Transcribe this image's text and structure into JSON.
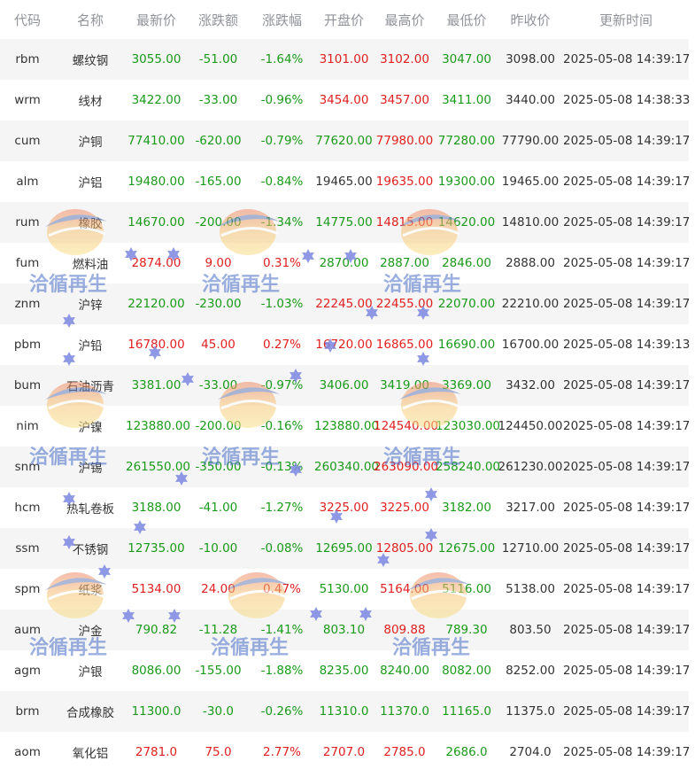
{
  "headers": [
    "代码",
    "名称",
    "最新价",
    "涨跌额",
    "涨跌幅",
    "开盘价",
    "最高价",
    "最低价",
    "昨收价",
    "更新时间"
  ],
  "colors": {
    "up": "#e02020",
    "down": "#1a9a1a",
    "flat": "#333333",
    "header": "#909399",
    "stripe": "#f5f5f5"
  },
  "rows": [
    {
      "code": "rbm",
      "name": "螺纹钢",
      "latest": "3055.00",
      "change": "-51.00",
      "pct": "-1.64%",
      "open": "3101.00",
      "high": "3102.00",
      "low": "3047.00",
      "prev": "3098.00",
      "time": "2025-05-08 14:39:17",
      "tone": {
        "latest": "down",
        "change": "down",
        "pct": "down",
        "open": "up",
        "high": "up",
        "low": "down"
      }
    },
    {
      "code": "wrm",
      "name": "线材",
      "latest": "3422.00",
      "change": "-33.00",
      "pct": "-0.96%",
      "open": "3454.00",
      "high": "3457.00",
      "low": "3411.00",
      "prev": "3440.00",
      "time": "2025-05-08 14:38:33",
      "tone": {
        "latest": "down",
        "change": "down",
        "pct": "down",
        "open": "up",
        "high": "up",
        "low": "down"
      }
    },
    {
      "code": "cum",
      "name": "沪铜",
      "latest": "77410.00",
      "change": "-620.00",
      "pct": "-0.79%",
      "open": "77620.00",
      "high": "77980.00",
      "low": "77280.00",
      "prev": "77790.00",
      "time": "2025-05-08 14:39:17",
      "tone": {
        "latest": "down",
        "change": "down",
        "pct": "down",
        "open": "down",
        "high": "up",
        "low": "down"
      }
    },
    {
      "code": "alm",
      "name": "沪铝",
      "latest": "19480.00",
      "change": "-165.00",
      "pct": "-0.84%",
      "open": "19465.00",
      "high": "19635.00",
      "low": "19300.00",
      "prev": "19465.00",
      "time": "2025-05-08 14:39:17",
      "tone": {
        "latest": "down",
        "change": "down",
        "pct": "down",
        "open": "flat",
        "high": "up",
        "low": "down"
      }
    },
    {
      "code": "rum",
      "name": "橡胶",
      "latest": "14670.00",
      "change": "-200.00",
      "pct": "-1.34%",
      "open": "14775.00",
      "high": "14815.00",
      "low": "14620.00",
      "prev": "14810.00",
      "time": "2025-05-08 14:39:17",
      "tone": {
        "latest": "down",
        "change": "down",
        "pct": "down",
        "open": "down",
        "high": "up",
        "low": "down"
      }
    },
    {
      "code": "fum",
      "name": "燃料油",
      "latest": "2874.00",
      "change": "9.00",
      "pct": "0.31%",
      "open": "2870.00",
      "high": "2887.00",
      "low": "2846.00",
      "prev": "2888.00",
      "time": "2025-05-08 14:39:17",
      "tone": {
        "latest": "up",
        "change": "up",
        "pct": "up",
        "open": "down",
        "high": "down",
        "low": "down"
      }
    },
    {
      "code": "znm",
      "name": "沪锌",
      "latest": "22120.00",
      "change": "-230.00",
      "pct": "-1.03%",
      "open": "22245.00",
      "high": "22455.00",
      "low": "22070.00",
      "prev": "22210.00",
      "time": "2025-05-08 14:39:17",
      "tone": {
        "latest": "down",
        "change": "down",
        "pct": "down",
        "open": "up",
        "high": "up",
        "low": "down"
      }
    },
    {
      "code": "pbm",
      "name": "沪铅",
      "latest": "16780.00",
      "change": "45.00",
      "pct": "0.27%",
      "open": "16720.00",
      "high": "16865.00",
      "low": "16690.00",
      "prev": "16700.00",
      "time": "2025-05-08 14:39:13",
      "tone": {
        "latest": "up",
        "change": "up",
        "pct": "up",
        "open": "up",
        "high": "up",
        "low": "down"
      }
    },
    {
      "code": "bum",
      "name": "石油沥青",
      "latest": "3381.00",
      "change": "-33.00",
      "pct": "-0.97%",
      "open": "3406.00",
      "high": "3419.00",
      "low": "3369.00",
      "prev": "3432.00",
      "time": "2025-05-08 14:39:17",
      "tone": {
        "latest": "down",
        "change": "down",
        "pct": "down",
        "open": "down",
        "high": "down",
        "low": "down"
      }
    },
    {
      "code": "nim",
      "name": "沪镍",
      "latest": "123880.00",
      "change": "-200.00",
      "pct": "-0.16%",
      "open": "123880.00",
      "high": "124540.00",
      "low": "123030.00",
      "prev": "124450.00",
      "time": "2025-05-08 14:39:17",
      "tone": {
        "latest": "down",
        "change": "down",
        "pct": "down",
        "open": "down",
        "high": "up",
        "low": "down"
      }
    },
    {
      "code": "snm",
      "name": "沪锡",
      "latest": "261550.00",
      "change": "-350.00",
      "pct": "-0.13%",
      "open": "260340.00",
      "high": "263090.00",
      "low": "258240.00",
      "prev": "261230.00",
      "time": "2025-05-08 14:39:17",
      "tone": {
        "latest": "down",
        "change": "down",
        "pct": "down",
        "open": "down",
        "high": "up",
        "low": "down"
      }
    },
    {
      "code": "hcm",
      "name": "热轧卷板",
      "latest": "3188.00",
      "change": "-41.00",
      "pct": "-1.27%",
      "open": "3225.00",
      "high": "3225.00",
      "low": "3182.00",
      "prev": "3217.00",
      "time": "2025-05-08 14:39:17",
      "tone": {
        "latest": "down",
        "change": "down",
        "pct": "down",
        "open": "up",
        "high": "up",
        "low": "down"
      }
    },
    {
      "code": "ssm",
      "name": "不锈钢",
      "latest": "12735.00",
      "change": "-10.00",
      "pct": "-0.08%",
      "open": "12695.00",
      "high": "12805.00",
      "low": "12675.00",
      "prev": "12710.00",
      "time": "2025-05-08 14:39:17",
      "tone": {
        "latest": "down",
        "change": "down",
        "pct": "down",
        "open": "down",
        "high": "up",
        "low": "down"
      }
    },
    {
      "code": "spm",
      "name": "纸浆",
      "latest": "5134.00",
      "change": "24.00",
      "pct": "0.47%",
      "open": "5130.00",
      "high": "5164.00",
      "low": "5116.00",
      "prev": "5138.00",
      "time": "2025-05-08 14:39:17",
      "tone": {
        "latest": "up",
        "change": "up",
        "pct": "up",
        "open": "down",
        "high": "up",
        "low": "down"
      }
    },
    {
      "code": "aum",
      "name": "沪金",
      "latest": "790.82",
      "change": "-11.28",
      "pct": "-1.41%",
      "open": "803.10",
      "high": "809.88",
      "low": "789.30",
      "prev": "803.50",
      "time": "2025-05-08 14:39:17",
      "tone": {
        "latest": "down",
        "change": "down",
        "pct": "down",
        "open": "down",
        "high": "up",
        "low": "down"
      }
    },
    {
      "code": "agm",
      "name": "沪银",
      "latest": "8086.00",
      "change": "-155.00",
      "pct": "-1.88%",
      "open": "8235.00",
      "high": "8240.00",
      "low": "8082.00",
      "prev": "8252.00",
      "time": "2025-05-08 14:39:17",
      "tone": {
        "latest": "down",
        "change": "down",
        "pct": "down",
        "open": "down",
        "high": "down",
        "low": "down"
      }
    },
    {
      "code": "brm",
      "name": "合成橡胶",
      "latest": "11300.0",
      "change": "-30.0",
      "pct": "-0.26%",
      "open": "11310.0",
      "high": "11370.0",
      "low": "11165.0",
      "prev": "11375.0",
      "time": "2025-05-08 14:39:17",
      "tone": {
        "latest": "down",
        "change": "down",
        "pct": "down",
        "open": "down",
        "high": "down",
        "low": "down"
      }
    },
    {
      "code": "aom",
      "name": "氧化铝",
      "latest": "2781.0",
      "change": "75.0",
      "pct": "2.77%",
      "open": "2707.0",
      "high": "2785.0",
      "low": "2686.0",
      "prev": "2704.0",
      "time": "2025-05-08 14:39:17",
      "tone": {
        "latest": "up",
        "change": "up",
        "pct": "up",
        "open": "up",
        "high": "up",
        "low": "down"
      }
    }
  ],
  "watermark": {
    "text": "洽循再生",
    "icon": "globe-logo-icon",
    "decor_icon": "star-icon"
  }
}
